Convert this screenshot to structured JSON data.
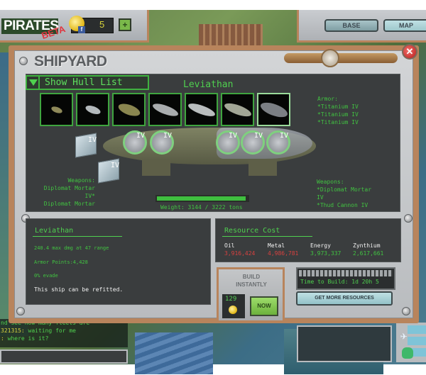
{
  "topbar": {
    "logo": "PIRATES",
    "beta": "BETA",
    "coins": "5",
    "plus_label": "+",
    "nav_base": "BASE",
    "nav_map": "MAP"
  },
  "window": {
    "title": "SHIPYARD",
    "close_label": "✕"
  },
  "hull_panel": {
    "show_hull_label": "Show Hull List",
    "ship_name": "Leviathan",
    "hull_count": 7,
    "selected_hull_index": 6,
    "armor_lines": [
      "Armor:",
      "*Titanium IV",
      "*Titanium IV",
      "*Titanium IV"
    ],
    "weapons_left_lines": [
      "Weapons:",
      "Diplomat Mortar",
      "IV*",
      "Diplomat Mortar"
    ],
    "weapons_right_lines": [
      "Weapons:",
      "*Diplomat Mortar",
      "IV",
      "*Thud Cannon IV"
    ],
    "slot_label": "IV",
    "weight_text": "Weight: 3144 / 3222 tons",
    "weight_current": 3144,
    "weight_max": 3222
  },
  "stats": {
    "name": "Leviathan",
    "damage": "240.4 max dmg at 47 range",
    "armor_points": "Armor Points:4,428",
    "evade": "0% evade",
    "refit": "This ship can be refitted."
  },
  "resources": {
    "title": "Resource Cost",
    "items": [
      {
        "name": "Oil",
        "value": "3,916,424",
        "color": "#d8413f"
      },
      {
        "name": "Metal",
        "value": "4,986,781",
        "color": "#d8413f"
      },
      {
        "name": "Energy",
        "value": "3,973,337",
        "color": "#41c341"
      },
      {
        "name": "Zynthium",
        "value": "2,617,661",
        "color": "#41c341"
      }
    ]
  },
  "build": {
    "label_line1": "BUILD",
    "label_line2": "INSTANTLY",
    "cost": "129",
    "now_label": "NOW",
    "time_text": "Time to Build: 1d 20h 5",
    "more_resources_label": "GET MORE RESOURCES"
  },
  "chat": {
    "lines": [
      {
        "prefix": "",
        "text": "nd see how many fleets are"
      },
      {
        "prefix": "321315:",
        "text": " waiting for me"
      },
      {
        "prefix": ":",
        "text": " where is it?"
      }
    ]
  }
}
